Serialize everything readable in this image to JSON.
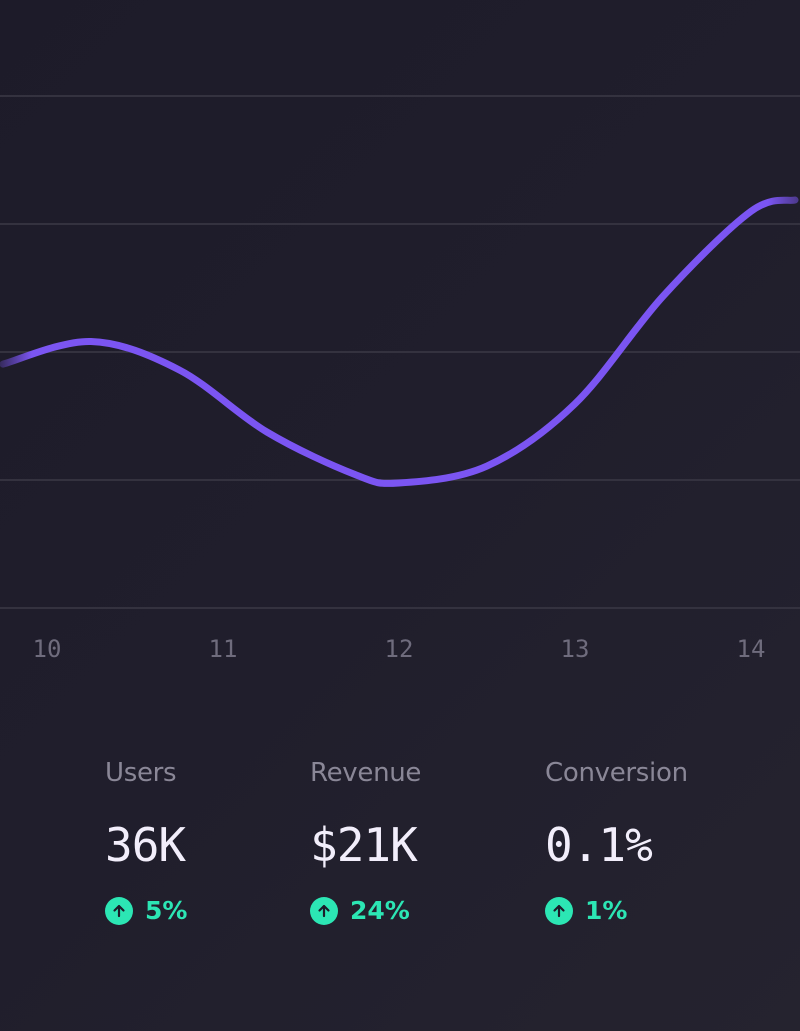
{
  "chart_data": {
    "type": "line",
    "x": [
      9.75,
      10.25,
      10.75,
      11.25,
      11.75,
      12,
      12.5,
      13,
      13.5,
      14,
      14.25
    ],
    "y_normalized": [
      0.42,
      0.5,
      0.4,
      0.18,
      0.03,
      0.0,
      0.06,
      0.28,
      0.66,
      0.96,
      1.0
    ],
    "xticks": [
      "10",
      "11",
      "12",
      "13",
      "14"
    ],
    "grid": true,
    "line_color": "#7b55f2",
    "grid_color": "#34323f"
  },
  "stats": [
    {
      "label": "Users",
      "value": "36K",
      "delta": "5%",
      "trend": "up"
    },
    {
      "label": "Revenue",
      "value": "$21K",
      "delta": "24%",
      "trend": "up"
    },
    {
      "label": "Conversion",
      "value": "0.1%",
      "delta": "1%",
      "trend": "up"
    }
  ],
  "colors": {
    "accent": "#7b55f2",
    "positive": "#2ce6b4",
    "value_text": "#f2eefb",
    "label_text": "#8a8797"
  },
  "icons": {
    "delta_up": "arrow-up-circle-icon"
  }
}
